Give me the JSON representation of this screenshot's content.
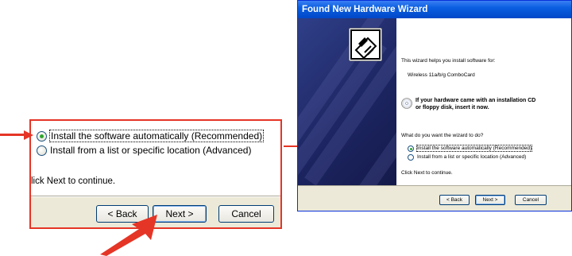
{
  "zoom": {
    "option_auto": "Install the software automatically (Recommended)",
    "option_manual": "Install from a list or specific location (Advanced)",
    "continue_text": "lick Next to continue.",
    "back_label": "< Back",
    "next_label": "Next >",
    "cancel_label": "Cancel"
  },
  "wizard": {
    "title": "Found New Hardware Wizard",
    "intro": "This wizard helps you install software for:",
    "device": "Wireless 11a/b/g ComboCard",
    "cd_line1": "If your hardware came with an installation CD",
    "cd_line2": "or floppy disk, insert it now.",
    "question": "What do you want the wizard to do?",
    "option_auto": "Install the software automatically (Recommended)",
    "option_manual": "Install from a list or specific location (Advanced)",
    "continue_text": "Click Next to continue.",
    "back_label": "< Back",
    "next_label": "Next >",
    "cancel_label": "Cancel"
  },
  "colors": {
    "highlight_red": "#e53526",
    "xp_blue": "#0a5ee0",
    "dialog_bg": "#ece9d8"
  },
  "icons": {
    "hardware": "hardware-install-icon",
    "cd": "cd-icon"
  }
}
